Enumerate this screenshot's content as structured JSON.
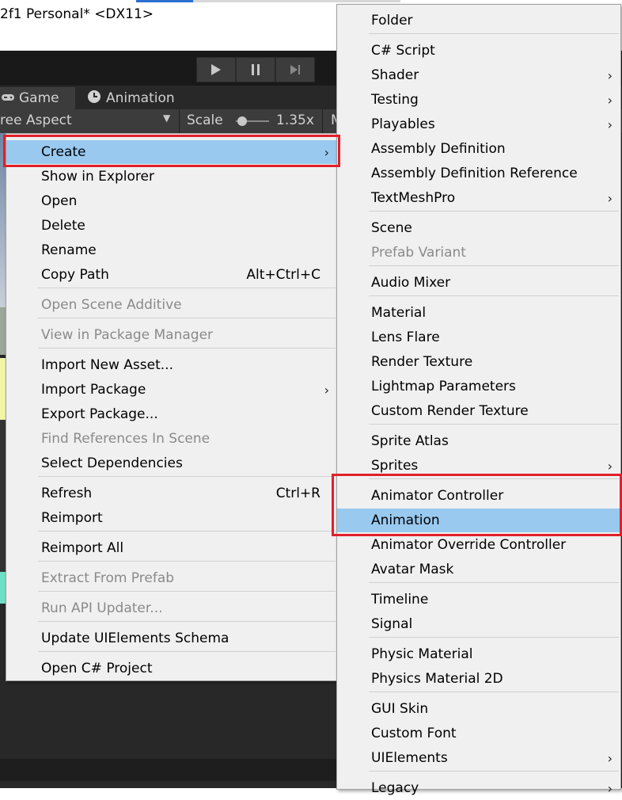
{
  "window": {
    "title": "2f1 Personal* <DX11>"
  },
  "tabs": {
    "game": "Game",
    "animation": "Animation"
  },
  "gamebar": {
    "aspect": "ree Aspect",
    "scale_label": "Scale",
    "scale_value": "1.35x",
    "trailing": "M"
  },
  "left_menu": {
    "create": "Create",
    "show_in_explorer": "Show in Explorer",
    "open": "Open",
    "delete": "Delete",
    "rename": "Rename",
    "copy_path": "Copy Path",
    "copy_path_shortcut": "Alt+Ctrl+C",
    "open_scene_additive": "Open Scene Additive",
    "view_in_package_manager": "View in Package Manager",
    "import_new_asset": "Import New Asset...",
    "import_package": "Import Package",
    "export_package": "Export Package...",
    "find_references": "Find References In Scene",
    "select_dependencies": "Select Dependencies",
    "refresh": "Refresh",
    "refresh_shortcut": "Ctrl+R",
    "reimport": "Reimport",
    "reimport_all": "Reimport All",
    "extract_from_prefab": "Extract From Prefab",
    "run_api_updater": "Run API Updater...",
    "update_uielements_schema": "Update UIElements Schema",
    "open_csharp_project": "Open C# Project"
  },
  "right_menu": {
    "folder": "Folder",
    "csharp_script": "C# Script",
    "shader": "Shader",
    "testing": "Testing",
    "playables": "Playables",
    "assembly_definition": "Assembly Definition",
    "assembly_definition_reference": "Assembly Definition Reference",
    "textmeshpro": "TextMeshPro",
    "scene": "Scene",
    "prefab_variant": "Prefab Variant",
    "audio_mixer": "Audio Mixer",
    "material": "Material",
    "lens_flare": "Lens Flare",
    "render_texture": "Render Texture",
    "lightmap_parameters": "Lightmap Parameters",
    "custom_render_texture": "Custom Render Texture",
    "sprite_atlas": "Sprite Atlas",
    "sprites": "Sprites",
    "animator_controller": "Animator Controller",
    "animation": "Animation",
    "animator_override_controller": "Animator Override Controller",
    "avatar_mask": "Avatar Mask",
    "timeline": "Timeline",
    "signal": "Signal",
    "physic_material": "Physic Material",
    "physics_material_2d": "Physics Material 2D",
    "gui_skin": "GUI Skin",
    "custom_font": "Custom Font",
    "uielements": "UIElements",
    "legacy": "Legacy"
  },
  "icons": {
    "play": "play-icon",
    "pause": "pause-icon",
    "step": "step-icon",
    "game": "gamepad-icon",
    "animation": "clock-icon",
    "submenu": "chevron-right-icon"
  },
  "colors": {
    "highlight": "#99c9ef",
    "annotation": "#e0202a",
    "menu_bg": "#f0f0f0",
    "editor_bg": "#282828"
  }
}
